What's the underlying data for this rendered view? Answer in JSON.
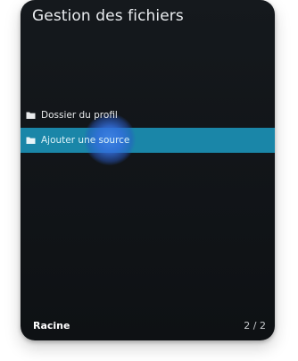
{
  "header": {
    "title": "Gestion des fichiers"
  },
  "list": {
    "items": [
      {
        "label": "Dossier du profil",
        "icon": "folder-icon",
        "selected": false
      },
      {
        "label": "Ajouter une source",
        "icon": "folder-icon",
        "selected": true
      }
    ]
  },
  "footer": {
    "location": "Racine",
    "page": "2 / 2"
  },
  "colors": {
    "background": "#15191d",
    "selection": "#1a86a8",
    "ripple": "#4082e6"
  }
}
